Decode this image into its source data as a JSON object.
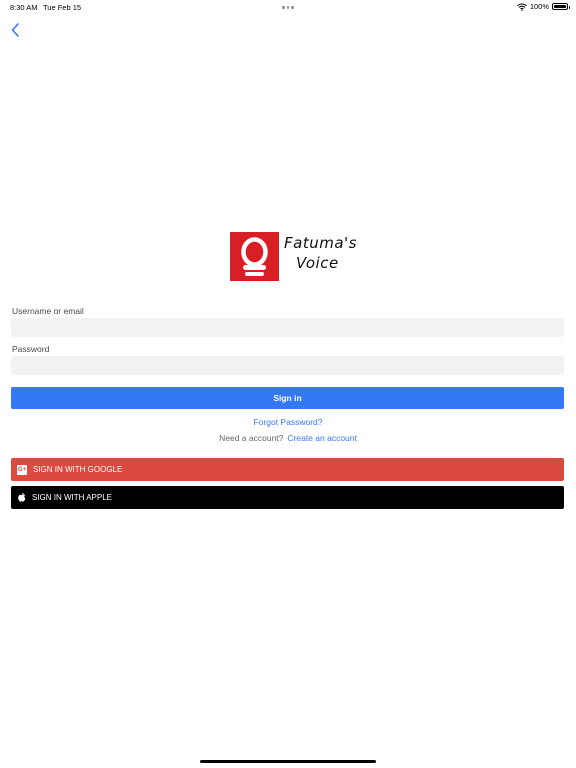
{
  "status_bar": {
    "time": "8:30 AM",
    "date": "Tue Feb 15",
    "battery": "100%",
    "battery_level": 1.0
  },
  "nav": {
    "back_icon": "chevron-left-icon"
  },
  "logo": {
    "line1": "Fatuma's",
    "line2": "Voice",
    "mark_color": "#d91f26"
  },
  "form": {
    "username_label": "Username or email",
    "username_value": "",
    "password_label": "Password",
    "password_value": "",
    "signin_label": "Sign in",
    "forgot_label": "Forgot Password?",
    "need_account_text": "Need a account?",
    "create_account_label": "Create an account"
  },
  "social": {
    "google_label": "SIGN IN WITH GOOGLE",
    "google_icon_text": "G+",
    "apple_label": "SIGN IN WITH APPLE"
  },
  "colors": {
    "accent": "#3478f6",
    "google": "#db4a3f",
    "apple": "#000000",
    "input_bg": "#f2f2f2"
  }
}
